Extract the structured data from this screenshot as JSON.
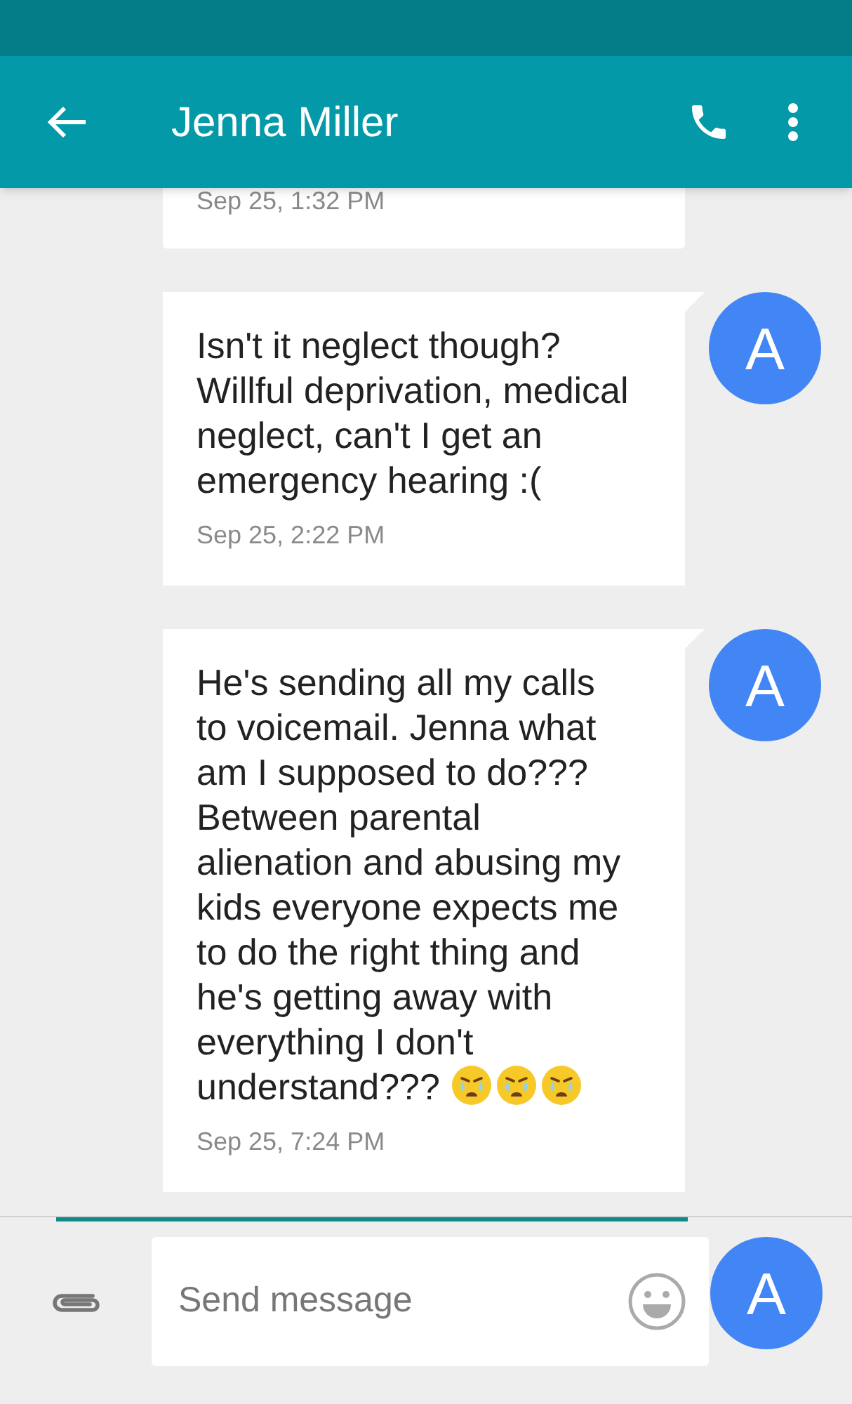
{
  "app_bar": {
    "title": "Jenna Miller"
  },
  "messages": [
    {
      "time": "Sep 25, 1:32 PM",
      "cut_top": true
    },
    {
      "text": "Isn't it neglect though? Willful deprivation, medical neglect, can't I get an emergency hearing :(",
      "time": "Sep 25, 2:22 PM",
      "avatar": "A",
      "cut_top": false
    },
    {
      "text": "He's sending all my calls to voicemail. Jenna what am I supposed to do??? Between parental alienation and abusing my kids everyone expects me to do the right thing and he's getting away with everything I don't understand???",
      "emojis": [
        {
          "kind": "crying-face"
        },
        {
          "kind": "crying-face"
        },
        {
          "kind": "crying-face"
        }
      ],
      "time": "Sep 25, 7:24 PM",
      "avatar": "A",
      "cut_top": false
    }
  ],
  "composer": {
    "placeholder": "Send message",
    "avatar": "A"
  }
}
